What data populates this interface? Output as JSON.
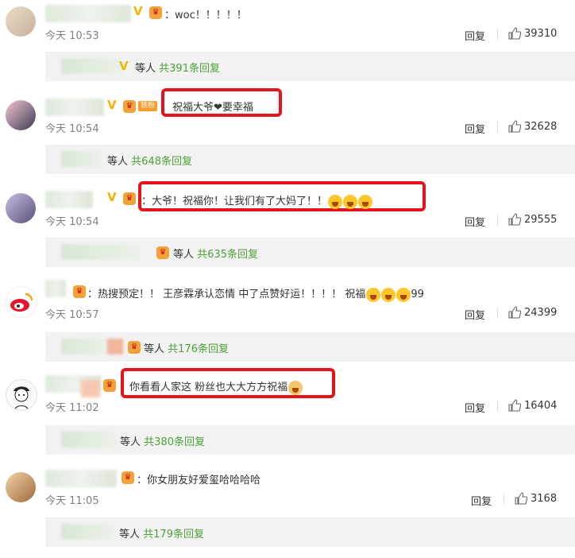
{
  "comments": [
    {
      "avatar": "avatar-photo-1",
      "text": "：woc！！！！！",
      "time": "今天 10:53",
      "reply_label": "回复",
      "likes": "39310",
      "sub_who": "等人",
      "sub_count": "共391条回复"
    },
    {
      "avatar": "avatar-photo-2",
      "fan_badge": "铁粉",
      "text": "祝福大爷❤要幸福",
      "time": "今天 10:54",
      "reply_label": "回复",
      "likes": "32628",
      "sub_who": "等人",
      "sub_count": "共648条回复"
    },
    {
      "avatar": "avatar-photo-3",
      "text": "：大爷！祝福你！让我们有了大妈了！！",
      "time": "今天 10:54",
      "reply_label": "回复",
      "likes": "29555",
      "sub_who": "等人",
      "sub_count": "共635条回复"
    },
    {
      "avatar": "weibo-logo-avatar",
      "text": "：热搜预定！！ 王彦霖承认恋情 中了点赞好运！！！！ 祝福",
      "text_suffix": "99",
      "time": "今天 10:57",
      "reply_label": "回复",
      "likes": "24399",
      "sub_who": "等人",
      "sub_count": "共176条回复"
    },
    {
      "avatar": "avatar-photo-5",
      "text": "你看看人家这 粉丝也大大方方祝福",
      "time": "今天 11:02",
      "reply_label": "回复",
      "likes": "16404",
      "sub_who": "等人",
      "sub_count": "共380条回复"
    },
    {
      "avatar": "avatar-photo-6",
      "text": "：你女朋友好爱玺哈哈哈哈",
      "time": "今天 11:05",
      "reply_label": "回复",
      "likes": "3168",
      "sub_who": "等人",
      "sub_count": "共179条回复"
    }
  ],
  "colors": {
    "highlight_box": "#e5131b",
    "reply_count": "#4ca136",
    "vip": "#f1b400"
  }
}
